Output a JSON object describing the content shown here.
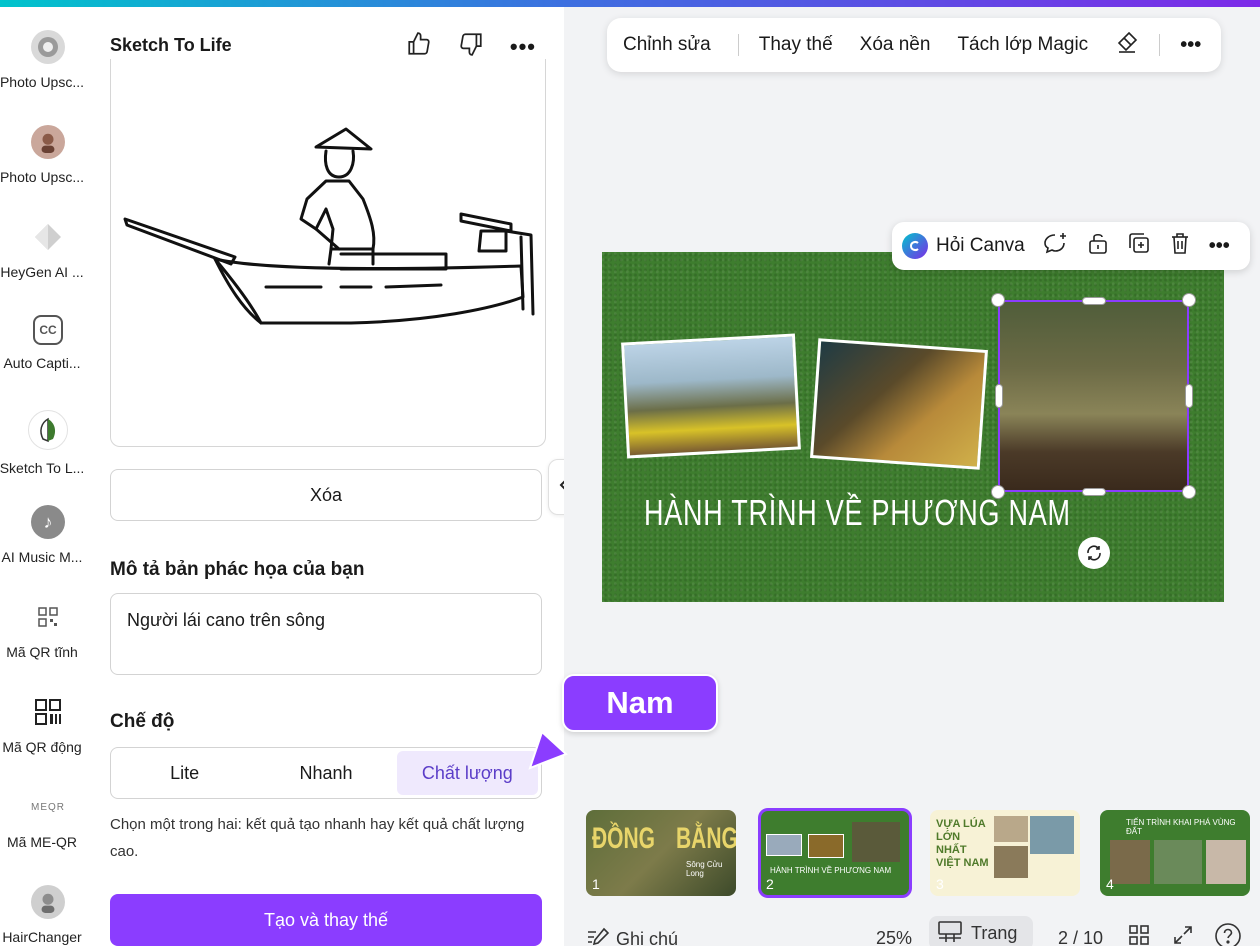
{
  "rail": {
    "items": [
      {
        "label": "Photo Upsc..."
      },
      {
        "label": "Photo Upsc..."
      },
      {
        "label": "HeyGen AI ..."
      },
      {
        "label": "Auto Capti..."
      },
      {
        "label": "Sketch To L..."
      },
      {
        "label": "AI Music M..."
      },
      {
        "label": "Mã QR tĩnh"
      },
      {
        "label": "Mã QR động"
      },
      {
        "label": "Mã ME-QR"
      },
      {
        "label": "HairChanger"
      }
    ],
    "icon_texts": {
      "cc": "CC",
      "meqr": "MEQR"
    }
  },
  "panel": {
    "title": "Sketch To Life",
    "clear_label": "Xóa",
    "describe_label": "Mô tả bản phác họa của bạn",
    "describe_value": "Người lái cano trên sông",
    "mode_label": "Chế độ",
    "modes": [
      "Lite",
      "Nhanh",
      "Chất lượng"
    ],
    "active_mode": "Chất lượng",
    "helper": "Chọn một trong hai: kết quả tạo nhanh hay kết quả chất lượng cao.",
    "create_label": "Tạo và thay thế"
  },
  "toolbar": {
    "edit": "Chỉnh sửa",
    "replace": "Thay thế",
    "remove_bg": "Xóa nền",
    "magic_layers": "Tách lớp Magic"
  },
  "context_menu": {
    "ask_canva": "Hỏi Canva"
  },
  "slide": {
    "title": "HÀNH TRÌNH VỀ PHƯƠNG NAM"
  },
  "tooltip": {
    "text": "Nam"
  },
  "thumbnails": [
    {
      "num": "1",
      "text_a": "ĐỒNG",
      "text_b": "BẰNG",
      "sub": "Sông Cửu Long"
    },
    {
      "num": "2",
      "text": "HÀNH TRÌNH VỀ PHƯƠNG NAM"
    },
    {
      "num": "3",
      "text": "VỰA LÚA LỚN NHẤT VIỆT NAM"
    },
    {
      "num": "4",
      "text": "TIẾN TRÌNH KHAI PHÁ VÙNG ĐẤT"
    }
  ],
  "bottom": {
    "notes": "Ghi chú",
    "zoom": "25%",
    "pages": "Trang",
    "page_count": "2 / 10"
  },
  "colors": {
    "accent": "#8b3dff",
    "slide_bg": "#3e7d2e"
  }
}
